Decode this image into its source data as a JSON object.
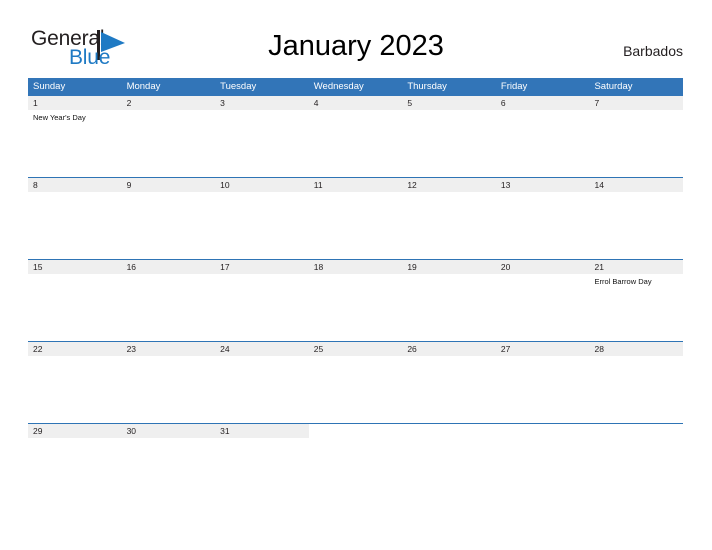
{
  "branding": {
    "logo_text_primary": "General",
    "logo_text_secondary": "Blue",
    "logo_flag_color": "#1f7ac4"
  },
  "header": {
    "title": "January 2023",
    "country": "Barbados"
  },
  "theme": {
    "header_blue": "#3275b8",
    "row_border_blue": "#2e74b5",
    "date_band_gray": "#efefef",
    "page_background": "#ffffff",
    "text_dark": "#231f20"
  },
  "weekdays": [
    "Sunday",
    "Monday",
    "Tuesday",
    "Wednesday",
    "Thursday",
    "Friday",
    "Saturday"
  ],
  "weeks": [
    {
      "days": [
        {
          "date": "1",
          "events": [
            "New Year's Day"
          ]
        },
        {
          "date": "2",
          "events": []
        },
        {
          "date": "3",
          "events": []
        },
        {
          "date": "4",
          "events": []
        },
        {
          "date": "5",
          "events": []
        },
        {
          "date": "6",
          "events": []
        },
        {
          "date": "7",
          "events": []
        }
      ]
    },
    {
      "days": [
        {
          "date": "8",
          "events": []
        },
        {
          "date": "9",
          "events": []
        },
        {
          "date": "10",
          "events": []
        },
        {
          "date": "11",
          "events": []
        },
        {
          "date": "12",
          "events": []
        },
        {
          "date": "13",
          "events": []
        },
        {
          "date": "14",
          "events": []
        }
      ]
    },
    {
      "days": [
        {
          "date": "15",
          "events": []
        },
        {
          "date": "16",
          "events": []
        },
        {
          "date": "17",
          "events": []
        },
        {
          "date": "18",
          "events": []
        },
        {
          "date": "19",
          "events": []
        },
        {
          "date": "20",
          "events": []
        },
        {
          "date": "21",
          "events": [
            "Errol Barrow Day"
          ]
        }
      ]
    },
    {
      "days": [
        {
          "date": "22",
          "events": []
        },
        {
          "date": "23",
          "events": []
        },
        {
          "date": "24",
          "events": []
        },
        {
          "date": "25",
          "events": []
        },
        {
          "date": "26",
          "events": []
        },
        {
          "date": "27",
          "events": []
        },
        {
          "date": "28",
          "events": []
        }
      ]
    },
    {
      "days": [
        {
          "date": "29",
          "events": []
        },
        {
          "date": "30",
          "events": []
        },
        {
          "date": "31",
          "events": []
        },
        {
          "date": "",
          "events": []
        },
        {
          "date": "",
          "events": []
        },
        {
          "date": "",
          "events": []
        },
        {
          "date": "",
          "events": []
        }
      ]
    }
  ]
}
